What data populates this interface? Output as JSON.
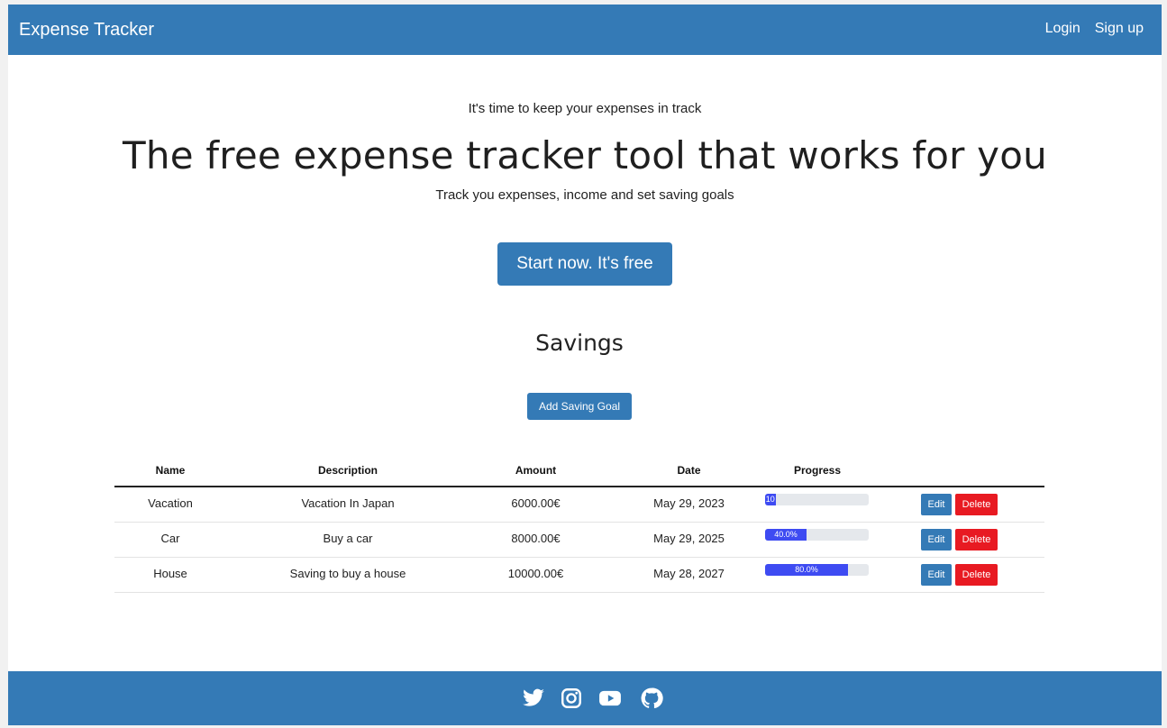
{
  "navbar": {
    "brand": "Expense Tracker",
    "login": "Login",
    "signup": "Sign up"
  },
  "hero": {
    "kicker": "It's time to keep your expenses in track",
    "title": "The free expense tracker tool that works for you",
    "subtitle": "Track you expenses, income and set saving goals",
    "cta": "Start now. It's free"
  },
  "savings": {
    "title": "Savings",
    "add_button": "Add Saving Goal",
    "columns": [
      "Name",
      "Description",
      "Amount",
      "Date",
      "Progress"
    ],
    "rows": [
      {
        "name": "Vacation",
        "description": "Vacation In Japan",
        "amount": "6000.00€",
        "date": "May 29, 2023",
        "progress_label": "10",
        "progress": 0.1,
        "edit": "Edit",
        "delete": "Delete"
      },
      {
        "name": "Car",
        "description": "Buy a car",
        "amount": "8000.00€",
        "date": "May 29, 2025",
        "progress_label": "40.0%",
        "progress": 0.4,
        "edit": "Edit",
        "delete": "Delete"
      },
      {
        "name": "House",
        "description": "Saving to buy a house",
        "amount": "10000.00€",
        "date": "May 28, 2027",
        "progress_label": "80.0%",
        "progress": 0.8,
        "edit": "Edit",
        "delete": "Delete"
      }
    ]
  },
  "footer": {
    "icons": [
      "twitter-icon",
      "instagram-icon",
      "youtube-icon",
      "github-icon"
    ]
  },
  "colors": {
    "primary": "#347ab6",
    "danger": "#e81a22",
    "progress": "#3e4bf2"
  }
}
